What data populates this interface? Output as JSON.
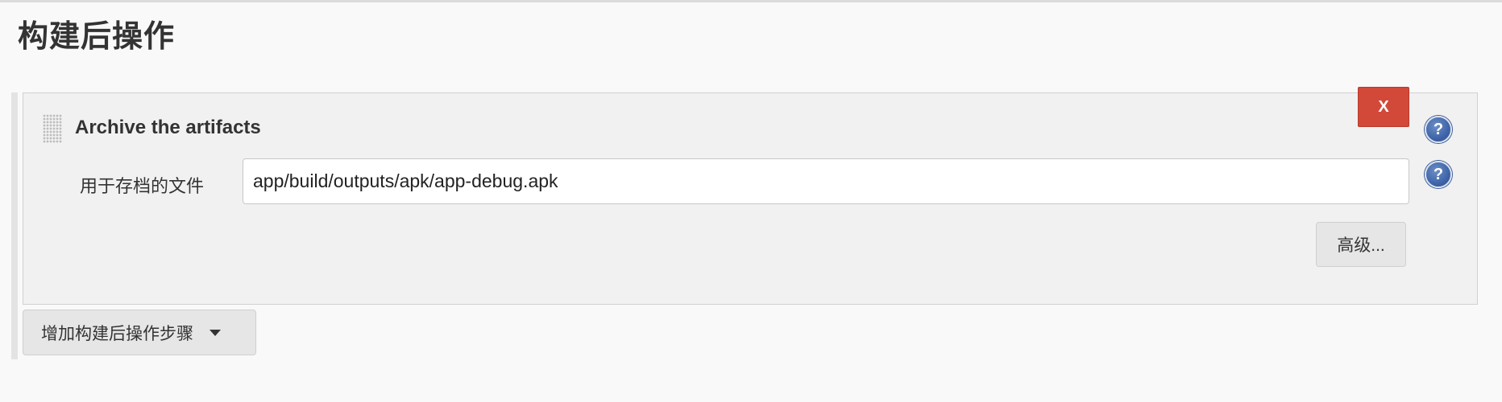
{
  "section": {
    "title": "构建后操作"
  },
  "step": {
    "title": "Archive the artifacts",
    "delete_label": "X",
    "field_label": "用于存档的文件",
    "field_value": "app/build/outputs/apk/app-debug.apk",
    "advanced_label": "高级..."
  },
  "help": {
    "glyph": "?",
    "icon": "help-circle-icon"
  },
  "add_step": {
    "label": "增加构建后操作步骤",
    "icon": "caret-down-icon"
  },
  "colors": {
    "delete_button": "#d24939",
    "help_icon": "#3f64a8",
    "panel_background": "#f1f1f1"
  }
}
